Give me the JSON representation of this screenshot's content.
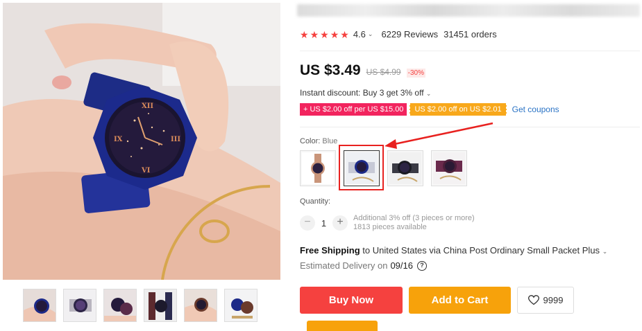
{
  "product": {
    "rating": "4.6",
    "reviews": "6229 Reviews",
    "orders": "31451 orders",
    "price": "US $3.49",
    "old_price": "US $4.99",
    "discount": "-30%",
    "instant_discount": "Instant discount: Buy 3 get 3% off",
    "coupons": [
      "+ US $2.00 off per US $15.00",
      "US $2.00 off on US $2.01"
    ],
    "get_coupons": "Get coupons",
    "color_label": "Color:",
    "color_value": "Blue",
    "quantity_label": "Quantity:",
    "quantity": "1",
    "quantity_note_1": "Additional 3% off (3 pieces or more)",
    "quantity_note_2": "1813 pieces available",
    "shipping_bold": "Free Shipping",
    "shipping_rest": " to United States via China Post Ordinary Small Packet Plus",
    "delivery_label": "Estimated Delivery on",
    "delivery_date": "09/16",
    "buy_now": "Buy Now",
    "add_to_cart": "Add to Cart",
    "wishlist_count": "9999"
  },
  "colors": {
    "red": "#f5413f",
    "orange": "#f7a20b",
    "coupon_pink": "#f2245e",
    "link_blue": "#2a73c5"
  },
  "icons": [
    "star-icon",
    "heart-icon",
    "question-icon",
    "plus-icon",
    "minus-icon",
    "chevron-down-icon"
  ]
}
